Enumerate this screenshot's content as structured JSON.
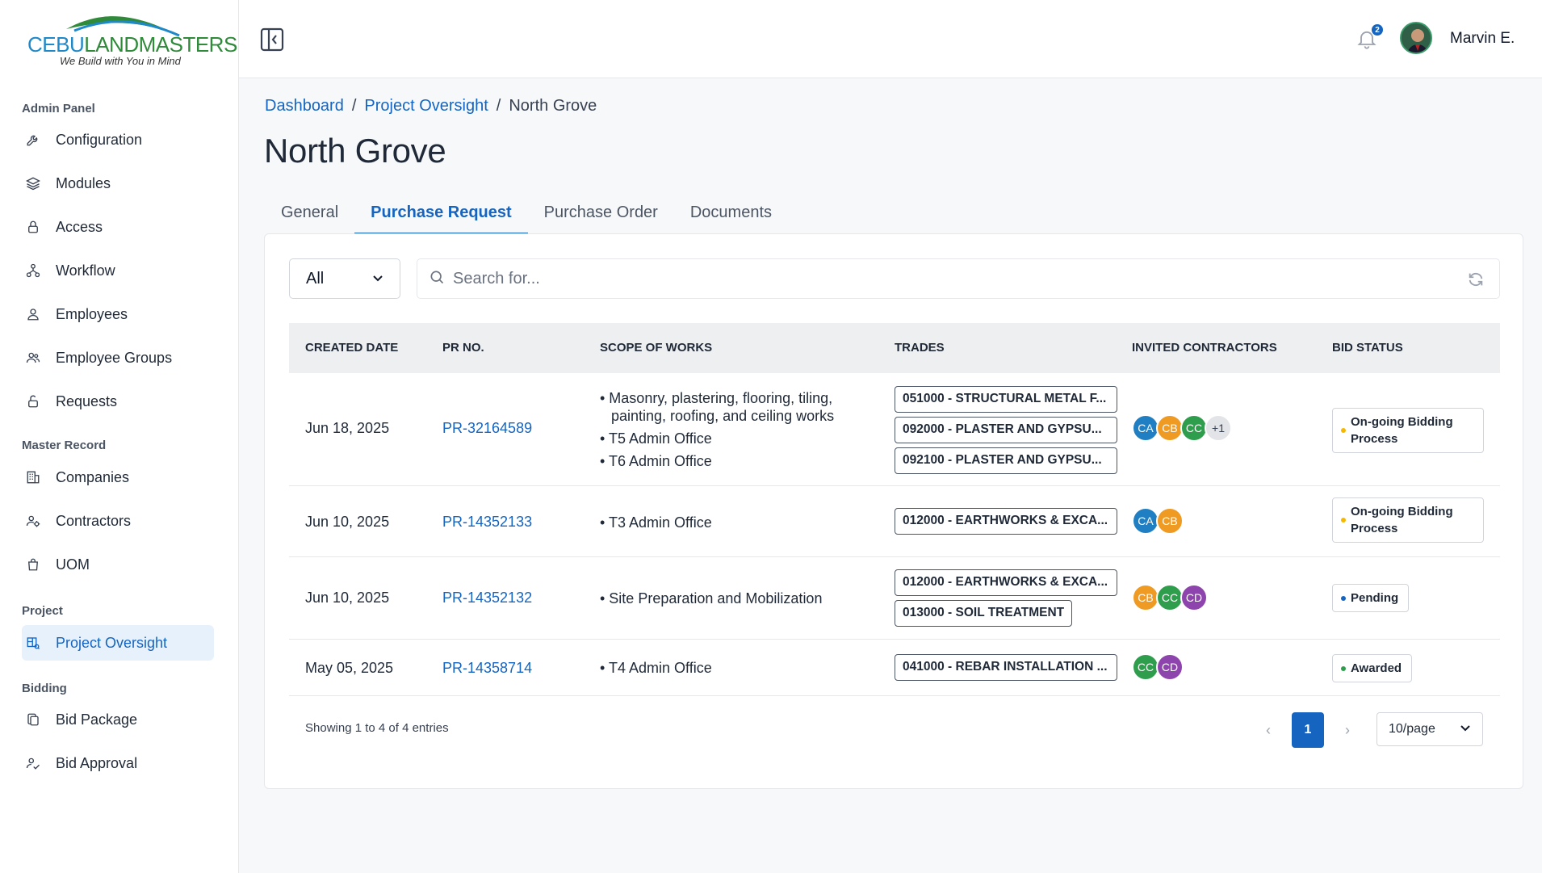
{
  "brand": {
    "name_part1": "CEBU",
    "name_part2": "LANDMASTERS",
    "tagline": "We Build with You in Mind"
  },
  "sidebar": {
    "sections": [
      {
        "title": "Admin Panel"
      },
      {
        "title": "Master Record"
      },
      {
        "title": "Project"
      },
      {
        "title": "Bidding"
      }
    ],
    "items": [
      {
        "label": "Configuration",
        "icon": "wrench-icon"
      },
      {
        "label": "Modules",
        "icon": "layers-icon"
      },
      {
        "label": "Access",
        "icon": "lock-icon"
      },
      {
        "label": "Workflow",
        "icon": "workflow-icon"
      },
      {
        "label": "Employees",
        "icon": "user-icon"
      },
      {
        "label": "Employee Groups",
        "icon": "users-icon"
      },
      {
        "label": "Requests",
        "icon": "unlock-icon"
      },
      {
        "label": "Companies",
        "icon": "building-icon"
      },
      {
        "label": "Contractors",
        "icon": "user-gear-icon"
      },
      {
        "label": "UOM",
        "icon": "bag-icon"
      },
      {
        "label": "Project Oversight",
        "icon": "blueprint-icon",
        "active": true
      },
      {
        "label": "Bid Package",
        "icon": "copy-icon"
      },
      {
        "label": "Bid Approval",
        "icon": "approval-icon"
      }
    ]
  },
  "header": {
    "notification_count": "2",
    "user_name": "Marvin E."
  },
  "breadcrumb": [
    "Dashboard",
    "Project Oversight",
    "North Grove"
  ],
  "page_title": "North Grove",
  "tabs": [
    {
      "label": "General"
    },
    {
      "label": "Purchase Request",
      "active": true
    },
    {
      "label": "Purchase Order"
    },
    {
      "label": "Documents"
    }
  ],
  "filter": {
    "selected": "All"
  },
  "search": {
    "placeholder": "Search for..."
  },
  "table": {
    "columns": [
      "CREATED DATE",
      "PR NO.",
      "SCOPE OF WORKS",
      "TRADES",
      "INVITED CONTRACTORS",
      "BID STATUS"
    ],
    "rows": [
      {
        "date": "Jun 18, 2025",
        "pr_no": "PR-32164589",
        "scope": [
          "• Masonry, plastering, flooring, tiling, painting, roofing, and ceiling works",
          "• T5 Admin Office",
          "• T6 Admin Office"
        ],
        "trades": [
          "051000 - STRUCTURAL METAL F...",
          "092000 - PLASTER AND GYPSU...",
          "092100 - PLASTER AND GYPSU..."
        ],
        "contractors": [
          "CA",
          "CB",
          "CC",
          "+1"
        ],
        "status": "On-going Bidding Process",
        "status_color": "#f5b800"
      },
      {
        "date": "Jun 10, 2025",
        "pr_no": "PR-14352133",
        "scope": [
          "• T3 Admin Office"
        ],
        "trades": [
          "012000 - EARTHWORKS & EXCA..."
        ],
        "contractors": [
          "CA",
          "CB"
        ],
        "status": "On-going Bidding Process",
        "status_color": "#f5b800"
      },
      {
        "date": "Jun 10, 2025",
        "pr_no": "PR-14352132",
        "scope": [
          "• Site Preparation and Mobilization"
        ],
        "trades": [
          "012000 - EARTHWORKS & EXCA...",
          "013000 - SOIL TREATMENT"
        ],
        "contractors": [
          "CB",
          "CC",
          "CD"
        ],
        "status": "Pending",
        "status_color": "#1565c0"
      },
      {
        "date": "May 05, 2025",
        "pr_no": "PR-14358714",
        "scope": [
          "• T4 Admin Office"
        ],
        "trades": [
          "041000 - REBAR INSTALLATION ..."
        ],
        "contractors": [
          "CC",
          "CD"
        ],
        "status": "Awarded",
        "status_color": "#2e9e4c"
      }
    ]
  },
  "pagination": {
    "info": "Showing 1 to 4 of 4 entries",
    "current_page": "1",
    "per_page": "10/page"
  },
  "colors": {
    "accent": "#1565c0",
    "active_bg": "#e7f1fb"
  }
}
